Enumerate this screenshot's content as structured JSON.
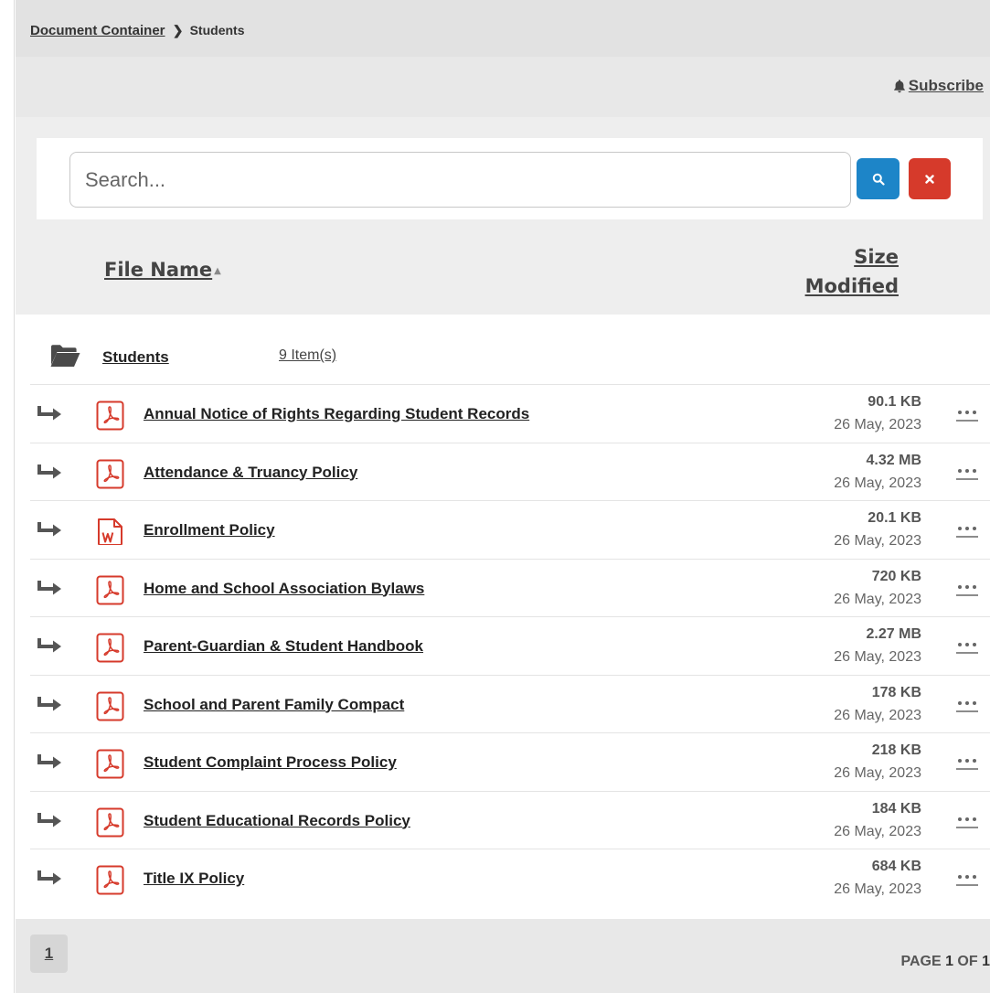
{
  "breadcrumb": {
    "root": "Document Container",
    "current": "Students"
  },
  "subscribe": {
    "label": "Subscribe",
    "icon": "bell-icon"
  },
  "search": {
    "placeholder": "Search...",
    "value": "",
    "search_icon": "search-icon",
    "clear_icon": "close-icon"
  },
  "table_header": {
    "file_name": "File Name",
    "size": "Size",
    "modified": "Modified",
    "sort_indicator": "▲"
  },
  "folder": {
    "name": "Students",
    "count": "9 Item(s)"
  },
  "files": [
    {
      "name": "Annual Notice of Rights Regarding Student Records",
      "size": "90.1 KB",
      "modified": "26 May, 2023",
      "type": "pdf"
    },
    {
      "name": "Attendance & Truancy Policy",
      "size": "4.32 MB",
      "modified": "26 May, 2023",
      "type": "pdf"
    },
    {
      "name": "Enrollment Policy",
      "size": "20.1 KB",
      "modified": "26 May, 2023",
      "type": "word"
    },
    {
      "name": "Home and School Association Bylaws",
      "size": "720 KB",
      "modified": "26 May, 2023",
      "type": "pdf"
    },
    {
      "name": "Parent-Guardian & Student Handbook",
      "size": "2.27 MB",
      "modified": "26 May, 2023",
      "type": "pdf"
    },
    {
      "name": "School and Parent Family Compact",
      "size": "178 KB",
      "modified": "26 May, 2023",
      "type": "pdf"
    },
    {
      "name": "Student Complaint Process Policy",
      "size": "218 KB",
      "modified": "26 May, 2023",
      "type": "pdf"
    },
    {
      "name": "Student Educational Records Policy",
      "size": "184 KB",
      "modified": "26 May, 2023",
      "type": "pdf"
    },
    {
      "name": "Title IX Policy",
      "size": "684 KB",
      "modified": "26 May, 2023",
      "type": "pdf"
    }
  ],
  "pagination": {
    "current_page": "1",
    "label_prefix": "PAGE",
    "page": "1",
    "label_of": "OF",
    "total": "1"
  },
  "colors": {
    "search_button": "#1d85c8",
    "clear_button": "#d63a2b",
    "file_icon": "#d63a2b"
  }
}
